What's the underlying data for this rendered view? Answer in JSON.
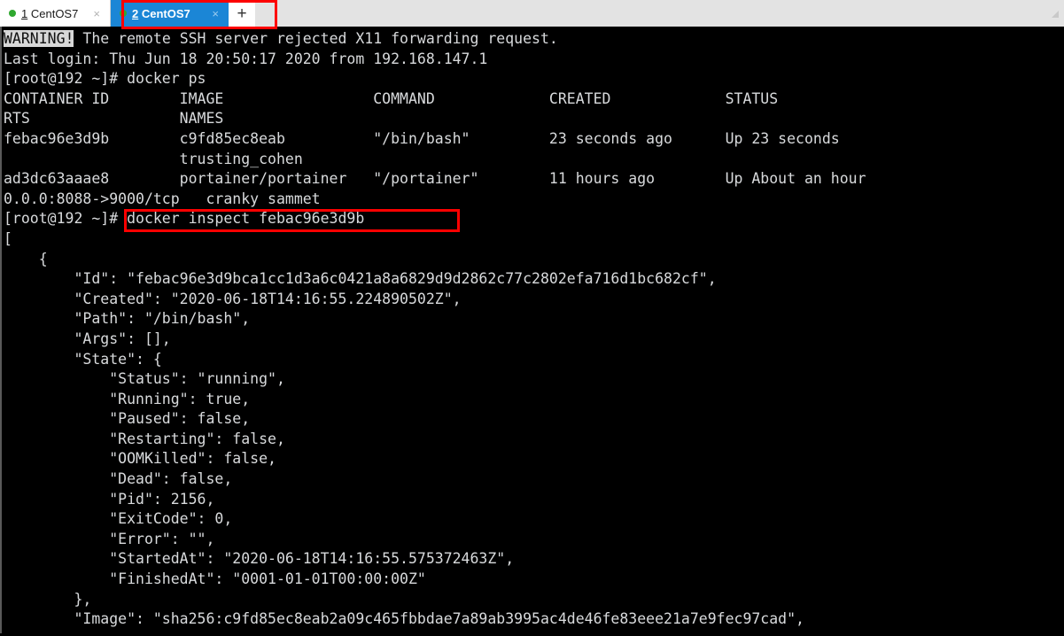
{
  "window": {
    "accent_color": "#1b86d6",
    "tabbar_bg": "#e3e3e3",
    "terminal_bg": "#000000",
    "terminal_fg": "#d8dadc",
    "annotation_color": "#fd0000"
  },
  "tabbar": {
    "tabs": [
      {
        "index": "1",
        "name": "CentOS7",
        "status_dot": "green",
        "close_glyph": "×",
        "active": false
      },
      {
        "index": "2",
        "name": "CentOS7",
        "status_dot": "green",
        "close_glyph": "×",
        "active": true
      }
    ],
    "new_tab_glyph": "+"
  },
  "terminal": {
    "warning_badge": "WARNING!",
    "warning_rest": " The remote SSH server rejected X11 forwarding request.",
    "lines": [
      "Last login: Thu Jun 18 20:50:17 2020 from 192.168.147.1",
      "[root@192 ~]# docker ps",
      "CONTAINER ID        IMAGE                 COMMAND             CREATED             STATUS",
      "RTS                 NAMES",
      "febac96e3d9b        c9fd85ec8eab          \"/bin/bash\"         23 seconds ago      Up 23 seconds",
      "                    trusting_cohen",
      "ad3dc63aaae8        portainer/portainer   \"/portainer\"        11 hours ago        Up About an hour",
      "0.0.0:8088->9000/tcp   cranky sammet",
      "[root@192 ~]# docker inspect febac96e3d9b",
      "[",
      "    {",
      "        \"Id\": \"febac96e3d9bca1cc1d3a6c0421a8a6829d9d2862c77c2802efa716d1bc682cf\",",
      "        \"Created\": \"2020-06-18T14:16:55.224890502Z\",",
      "        \"Path\": \"/bin/bash\",",
      "        \"Args\": [],",
      "        \"State\": {",
      "            \"Status\": \"running\",",
      "            \"Running\": true,",
      "            \"Paused\": false,",
      "            \"Restarting\": false,",
      "            \"OOMKilled\": false,",
      "            \"Dead\": false,",
      "            \"Pid\": 2156,",
      "            \"ExitCode\": 0,",
      "            \"Error\": \"\",",
      "            \"StartedAt\": \"2020-06-18T14:16:55.575372463Z\",",
      "            \"FinishedAt\": \"0001-01-01T00:00:00Z\"",
      "        },",
      "        \"Image\": \"sha256:c9fd85ec8eab2a09c465fbbdae7a89ab3995ac4de46fe83eee21a7e9fec97cad\","
    ]
  },
  "annotations": [
    {
      "id": "redbox-tab",
      "target": "active-tab"
    },
    {
      "id": "redbox-cmd",
      "target": "docker-inspect-command"
    }
  ]
}
